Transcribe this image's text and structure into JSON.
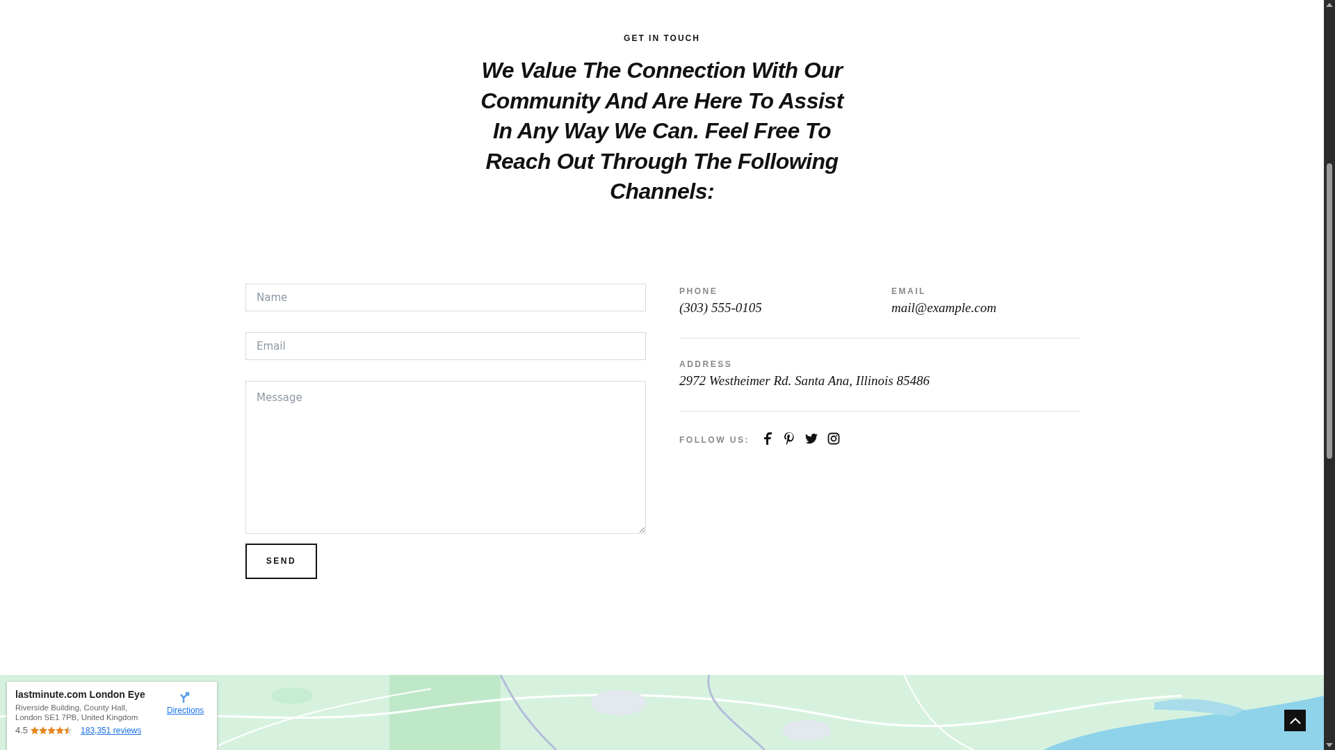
{
  "section": {
    "eyebrow": "GET IN TOUCH",
    "heading": "We Value The Connection With Our Community And Are Here To Assist In Any Way We Can. Feel Free To Reach Out Through The Following Channels:"
  },
  "form": {
    "fields": [
      {
        "kind": "input",
        "placeholder": "Name"
      },
      {
        "kind": "input",
        "placeholder": "Email"
      },
      {
        "kind": "textarea",
        "placeholder": "Message"
      }
    ],
    "submit": "SEND"
  },
  "contact": {
    "rows": [
      [
        {
          "label": "PHONE",
          "value": "(303) 555-0105"
        },
        {
          "label": "EMAIL",
          "value": "mail@example.com"
        }
      ],
      [
        {
          "label": "ADDRESS",
          "value": "2972 Westheimer Rd. Santa Ana, Illinois 85486"
        }
      ]
    ],
    "follow_label": "FOLLOW US:",
    "social": [
      {
        "kind": "facebook"
      },
      {
        "kind": "pinterest"
      },
      {
        "kind": "twitter"
      },
      {
        "kind": "instagram"
      }
    ]
  },
  "map": {
    "kind": "picture",
    "place": {
      "name": "lastminute.com London Eye",
      "address": [
        "Riverside Building, County Hall,",
        "London SE1 7PB, United Kingdom"
      ],
      "rating": "4.5",
      "stars": 4.5,
      "reviews": "183,351 reviews",
      "directions": "Directions"
    }
  }
}
